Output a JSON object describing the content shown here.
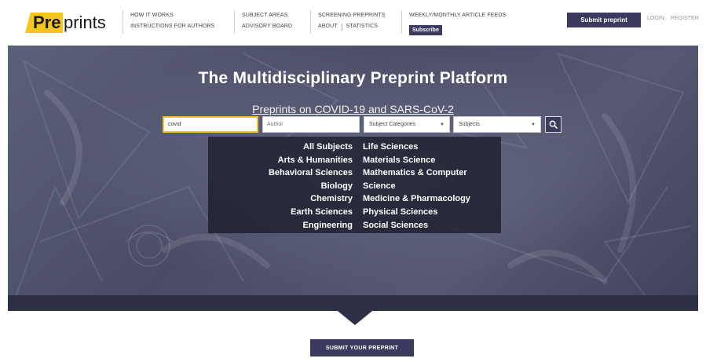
{
  "header": {
    "logo": {
      "pre": "Pre",
      "prints": "prints"
    },
    "nav": {
      "how_it_works": "HOW IT WORKS",
      "instructions": "INSTRUCTIONS FOR AUTHORS",
      "subject_areas": "SUBJECT AREAS",
      "advisory_board": "ADVISORY BOARD",
      "screening": "SCREENING PREPRINTS",
      "about": "ABOUT",
      "statistics": "STATISTICS",
      "feeds": "WEEKLY/MONTHLY ARTICLE FEEDS",
      "subscribe": "Subscribe"
    },
    "submit_label": "Submit preprint",
    "login": "LOGIN",
    "register": "REGISTER"
  },
  "hero": {
    "title": "The Multidisciplinary Preprint Platform",
    "search": {
      "keyword_value": "covid",
      "author_placeholder": "Author",
      "subject_categories": "Subject Categories",
      "subjects": "Subjects",
      "search_icon": "search-icon"
    },
    "covid_link": "Preprints on COVID-19 and SARS-CoV-2",
    "subjects_left": [
      "All Subjects",
      "Arts & Humanities",
      "Behavioral Sciences",
      "Biology",
      "Chemistry",
      "Earth Sciences",
      "Engineering"
    ],
    "subjects_right": [
      "Life Sciences",
      "Materials Science",
      "Mathematics & Computer",
      "Science",
      "Medicine & Pharmacology",
      "Physical Sciences",
      "Social Sciences"
    ]
  },
  "footer": {
    "submit_label": "SUBMIT YOUR PREPRINT"
  },
  "colors": {
    "brand": "#3c3a5e",
    "accent": "#f2c61f",
    "hero_bg": "#4f5169"
  }
}
